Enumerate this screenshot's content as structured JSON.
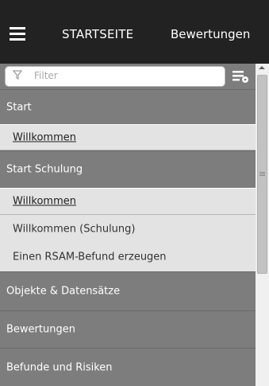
{
  "header": {
    "nav": [
      {
        "label": "STARTSEITE"
      },
      {
        "label": "Bewertungen"
      }
    ]
  },
  "filter": {
    "placeholder": "Filter"
  },
  "menu": {
    "sections": [
      {
        "label": "Start",
        "items": [
          {
            "label": "Willkommen",
            "active": true
          }
        ]
      },
      {
        "label": "Start Schulung",
        "items": [
          {
            "label": "Willkommen",
            "active": true
          },
          {
            "label": "Willkommen (Schulung)"
          },
          {
            "label": "Einen RSAM-Befund erzeugen"
          }
        ]
      },
      {
        "label": "Objekte & Datensätze"
      },
      {
        "label": "Bewertungen"
      },
      {
        "label": "Befunde und Risiken"
      }
    ]
  },
  "icons": {
    "menu": "hamburger-icon",
    "filter": "filter-funnel-icon",
    "list_options": "list-options-icon",
    "scroll_up": "scroll-up-arrow-icon"
  },
  "colors": {
    "header_bg": "#222222",
    "section_bg": "#7d7d7d",
    "item_bg": "#e3e3e3"
  }
}
